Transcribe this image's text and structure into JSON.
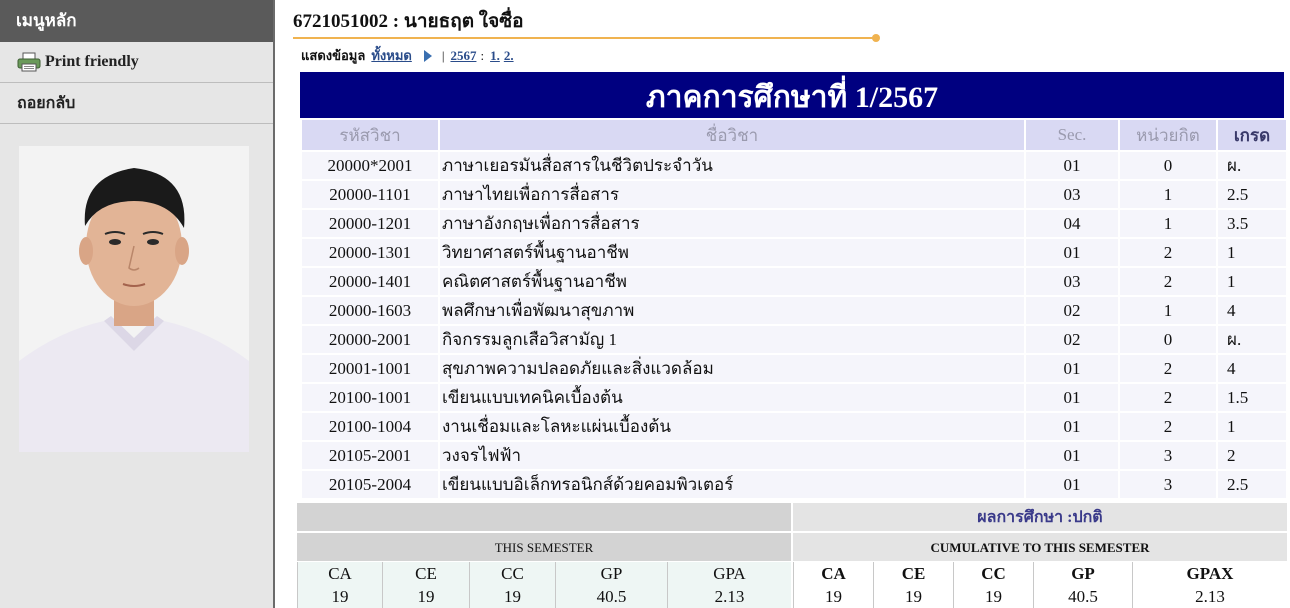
{
  "sidebar": {
    "header": "เมนูหลัก",
    "items": [
      {
        "label": "Print friendly",
        "icon": "printer-icon"
      },
      {
        "label": "ถอยกลับ"
      }
    ]
  },
  "student": {
    "title": "6721051002 : นายธฤต ใจซื่อ"
  },
  "filter": {
    "label": "แสดงข้อมูล",
    "all_link": "ทั้งหมด",
    "separator": "|",
    "year_link": "2567",
    "colon": ":",
    "term1_link": "1.",
    "term2_link": "2."
  },
  "semester": {
    "title": "ภาคการศึกษาที่ 1/2567"
  },
  "table": {
    "headers": {
      "code": "รหัสวิชา",
      "name": "ชื่อวิชา",
      "sec": "Sec.",
      "credit": "หน่วยกิต",
      "grade": "เกรด"
    },
    "rows": [
      {
        "code": "20000*2001",
        "name": "ภาษาเยอรมันสื่อสารในชีวิตประจำวัน",
        "sec": "01",
        "credit": "0",
        "grade": "ผ."
      },
      {
        "code": "20000-1101",
        "name": "ภาษาไทยเพื่อการสื่อสาร",
        "sec": "03",
        "credit": "1",
        "grade": "2.5"
      },
      {
        "code": "20000-1201",
        "name": "ภาษาอังกฤษเพื่อการสื่อสาร",
        "sec": "04",
        "credit": "1",
        "grade": "3.5"
      },
      {
        "code": "20000-1301",
        "name": "วิทยาศาสตร์พื้นฐานอาชีพ",
        "sec": "01",
        "credit": "2",
        "grade": "1"
      },
      {
        "code": "20000-1401",
        "name": "คณิตศาสตร์พื้นฐานอาชีพ",
        "sec": "03",
        "credit": "2",
        "grade": "1"
      },
      {
        "code": "20000-1603",
        "name": "พลศึกษาเพื่อพัฒนาสุขภาพ",
        "sec": "02",
        "credit": "1",
        "grade": "4"
      },
      {
        "code": "20000-2001",
        "name": "กิจกรรมลูกเสือวิสามัญ 1",
        "sec": "02",
        "credit": "0",
        "grade": "ผ."
      },
      {
        "code": "20001-1001",
        "name": "สุขภาพความปลอดภัยและสิ่งแวดล้อม",
        "sec": "01",
        "credit": "2",
        "grade": "4"
      },
      {
        "code": "20100-1001",
        "name": "เขียนแบบเทคนิคเบื้องต้น",
        "sec": "01",
        "credit": "2",
        "grade": "1.5"
      },
      {
        "code": "20100-1004",
        "name": "งานเชื่อมและโลหะแผ่นเบื้องต้น",
        "sec": "01",
        "credit": "2",
        "grade": "1"
      },
      {
        "code": "20105-2001",
        "name": "วงจรไฟฟ้า",
        "sec": "01",
        "credit": "3",
        "grade": "2"
      },
      {
        "code": "20105-2004",
        "name": "เขียนแบบอิเล็กทรอนิกส์ด้วยคอมพิวเตอร์",
        "sec": "01",
        "credit": "3",
        "grade": "2.5"
      }
    ]
  },
  "summary": {
    "result_label": "ผลการศึกษา :ปกติ",
    "this_semester_label": "THIS SEMESTER",
    "cumulative_label": "CUMULATIVE TO THIS SEMESTER",
    "this_semester": [
      {
        "key": "CA",
        "value": "19"
      },
      {
        "key": "CE",
        "value": "19"
      },
      {
        "key": "CC",
        "value": "19"
      },
      {
        "key": "GP",
        "value": "40.5"
      },
      {
        "key": "GPA",
        "value": "2.13"
      }
    ],
    "cumulative": [
      {
        "key": "CA",
        "value": "19"
      },
      {
        "key": "CE",
        "value": "19"
      },
      {
        "key": "CC",
        "value": "19"
      },
      {
        "key": "GP",
        "value": "40.5"
      },
      {
        "key": "GPAX",
        "value": "2.13"
      }
    ]
  },
  "colors": {
    "banner": "#000080",
    "accent_rule": "#f0b350",
    "header_bg": "#d9d9f3",
    "row_bg": "#f5f5fb",
    "sidebar_bg": "#e6e6e6",
    "sidebar_header_bg": "#5a5a5a"
  }
}
